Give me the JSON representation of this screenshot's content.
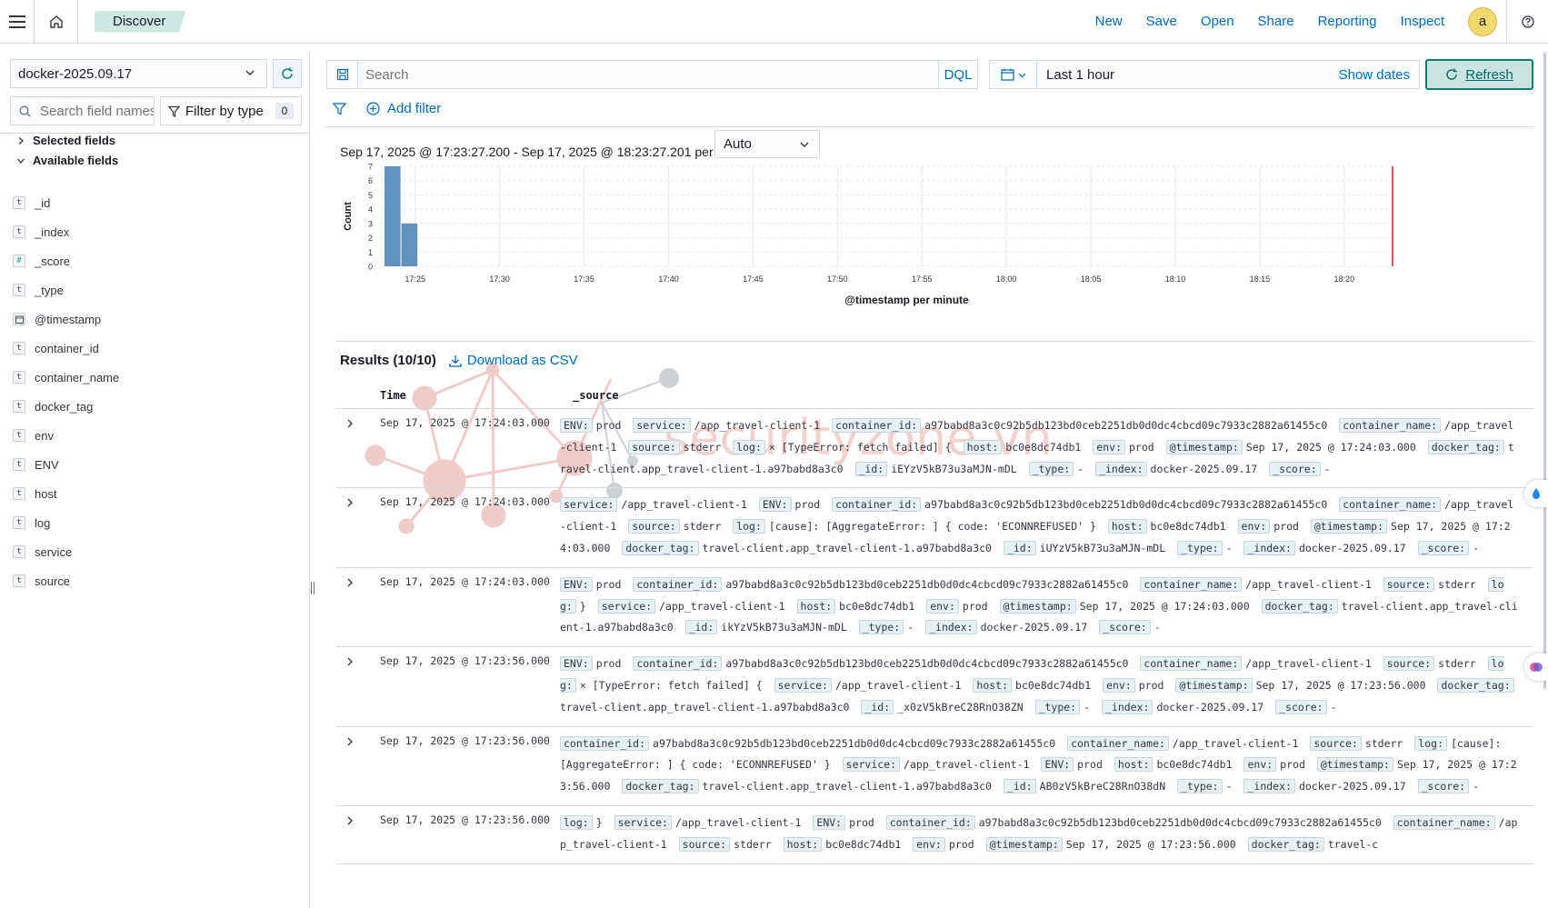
{
  "header": {
    "breadcrumb": "Discover",
    "nav": [
      "New",
      "Save",
      "Open",
      "Share",
      "Reporting",
      "Inspect"
    ],
    "avatar": "a"
  },
  "sidebar": {
    "index_pattern": "docker-2025.09.17",
    "field_search_placeholder": "Search field names",
    "filter_by_type": "Filter by type",
    "filter_count": "0",
    "selected_fields": "Selected fields",
    "available_fields": "Available fields",
    "fields": [
      {
        "type": "t",
        "name": "_id"
      },
      {
        "type": "t",
        "name": "_index"
      },
      {
        "type": "#",
        "name": "_score"
      },
      {
        "type": "t",
        "name": "_type"
      },
      {
        "type": "date",
        "name": "@timestamp"
      },
      {
        "type": "t",
        "name": "container_id"
      },
      {
        "type": "t",
        "name": "container_name"
      },
      {
        "type": "t",
        "name": "docker_tag"
      },
      {
        "type": "t",
        "name": "env"
      },
      {
        "type": "t",
        "name": "ENV"
      },
      {
        "type": "t",
        "name": "host"
      },
      {
        "type": "t",
        "name": "log"
      },
      {
        "type": "t",
        "name": "service"
      },
      {
        "type": "t",
        "name": "source"
      }
    ]
  },
  "query": {
    "placeholder": "Search",
    "language": "DQL",
    "time_range": "Last 1 hour",
    "show_dates": "Show dates",
    "refresh": "Refresh",
    "add_filter": "Add filter"
  },
  "histogram": {
    "interval_text": "Sep 17, 2025 @ 17:23:27.200 - Sep 17, 2025 @ 18:23:27.201 per",
    "interval": "Auto"
  },
  "chart_data": {
    "type": "bar",
    "xlabel": "@timestamp per minute",
    "ylabel": "Count",
    "ylim": [
      0,
      7
    ],
    "yticks": [
      "0",
      "1",
      "2",
      "3",
      "4",
      "5",
      "6",
      "7"
    ],
    "xticks": [
      "17:25",
      "17:30",
      "17:35",
      "17:40",
      "17:45",
      "17:50",
      "17:55",
      "18:00",
      "18:05",
      "18:10",
      "18:15",
      "18:20"
    ],
    "categories": [
      "17:24",
      "17:25"
    ],
    "values": [
      7,
      3
    ],
    "grid": true,
    "color": "#6092c0",
    "now_marker_color": "#bd271e"
  },
  "results": {
    "count_label": "Results (10/10)",
    "download": "Download as CSV",
    "col_time": "Time",
    "col_source": "_source",
    "rows": [
      {
        "time": "Sep 17, 2025 @ 17:24:03.000",
        "fields": [
          [
            "ENV:",
            "prod"
          ],
          [
            "service:",
            "/app_travel-client-1"
          ],
          [
            "container_id:",
            "a97babd8a3c0c92b5db123bd0ceb2251db0d0dc4cbcd09c7933c2882a61455c0"
          ],
          [
            "container_name:",
            "/app_travel-client-1"
          ],
          [
            "source:",
            "stderr"
          ],
          [
            "log:",
            "× [TypeError: fetch failed] {"
          ],
          [
            "host:",
            "bc0e8dc74db1"
          ],
          [
            "env:",
            "prod"
          ],
          [
            "@timestamp:",
            "Sep 17, 2025 @ 17:24:03.000"
          ],
          [
            "docker_tag:",
            "travel-client.app_travel-client-1.a97babd8a3c0"
          ],
          [
            "_id:",
            "iEYzV5kB73u3aMJN-mDL"
          ],
          [
            "_type:",
            "-"
          ],
          [
            "_index:",
            "docker-2025.09.17"
          ],
          [
            "_score:",
            "-"
          ]
        ]
      },
      {
        "time": "Sep 17, 2025 @ 17:24:03.000",
        "fields": [
          [
            "service:",
            "/app_travel-client-1"
          ],
          [
            "ENV:",
            "prod"
          ],
          [
            "container_id:",
            "a97babd8a3c0c92b5db123bd0ceb2251db0d0dc4cbcd09c7933c2882a61455c0"
          ],
          [
            "container_name:",
            "/app_travel-client-1"
          ],
          [
            "source:",
            "stderr"
          ],
          [
            "log:",
            "[cause]: [AggregateError: ] { code: 'ECONNREFUSED' }"
          ],
          [
            "host:",
            "bc0e8dc74db1"
          ],
          [
            "env:",
            "prod"
          ],
          [
            "@timestamp:",
            "Sep 17, 2025 @ 17:24:03.000"
          ],
          [
            "docker_tag:",
            "travel-client.app_travel-client-1.a97babd8a3c0"
          ],
          [
            "_id:",
            "iUYzV5kB73u3aMJN-mDL"
          ],
          [
            "_type:",
            "-"
          ],
          [
            "_index:",
            "docker-2025.09.17"
          ],
          [
            "_score:",
            "-"
          ]
        ]
      },
      {
        "time": "Sep 17, 2025 @ 17:24:03.000",
        "fields": [
          [
            "ENV:",
            "prod"
          ],
          [
            "container_id:",
            "a97babd8a3c0c92b5db123bd0ceb2251db0d0dc4cbcd09c7933c2882a61455c0"
          ],
          [
            "container_name:",
            "/app_travel-client-1"
          ],
          [
            "source:",
            "stderr"
          ],
          [
            "log:",
            "}"
          ],
          [
            "service:",
            "/app_travel-client-1"
          ],
          [
            "host:",
            "bc0e8dc74db1"
          ],
          [
            "env:",
            "prod"
          ],
          [
            "@timestamp:",
            "Sep 17, 2025 @ 17:24:03.000"
          ],
          [
            "docker_tag:",
            "travel-client.app_travel-client-1.a97babd8a3c0"
          ],
          [
            "_id:",
            "ikYzV5kB73u3aMJN-mDL"
          ],
          [
            "_type:",
            "-"
          ],
          [
            "_index:",
            "docker-2025.09.17"
          ],
          [
            "_score:",
            "-"
          ]
        ]
      },
      {
        "time": "Sep 17, 2025 @ 17:23:56.000",
        "fields": [
          [
            "ENV:",
            "prod"
          ],
          [
            "container_id:",
            "a97babd8a3c0c92b5db123bd0ceb2251db0d0dc4cbcd09c7933c2882a61455c0"
          ],
          [
            "container_name:",
            "/app_travel-client-1"
          ],
          [
            "source:",
            "stderr"
          ],
          [
            "log:",
            "× [TypeError: fetch failed] {"
          ],
          [
            "service:",
            "/app_travel-client-1"
          ],
          [
            "host:",
            "bc0e8dc74db1"
          ],
          [
            "env:",
            "prod"
          ],
          [
            "@timestamp:",
            "Sep 17, 2025 @ 17:23:56.000"
          ],
          [
            "docker_tag:",
            "travel-client.app_travel-client-1.a97babd8a3c0"
          ],
          [
            "_id:",
            "_x0zV5kBreC28RnO38ZN"
          ],
          [
            "_type:",
            "-"
          ],
          [
            "_index:",
            "docker-2025.09.17"
          ],
          [
            "_score:",
            "-"
          ]
        ]
      },
      {
        "time": "Sep 17, 2025 @ 17:23:56.000",
        "fields": [
          [
            "container_id:",
            "a97babd8a3c0c92b5db123bd0ceb2251db0d0dc4cbcd09c7933c2882a61455c0"
          ],
          [
            "container_name:",
            "/app_travel-client-1"
          ],
          [
            "source:",
            "stderr"
          ],
          [
            "log:",
            "[cause]: [AggregateError: ] { code: 'ECONNREFUSED' }"
          ],
          [
            "service:",
            "/app_travel-client-1"
          ],
          [
            "ENV:",
            "prod"
          ],
          [
            "host:",
            "bc0e8dc74db1"
          ],
          [
            "env:",
            "prod"
          ],
          [
            "@timestamp:",
            "Sep 17, 2025 @ 17:23:56.000"
          ],
          [
            "docker_tag:",
            "travel-client.app_travel-client-1.a97babd8a3c0"
          ],
          [
            "_id:",
            "AB0zV5kBreC28RnO38dN"
          ],
          [
            "_type:",
            "-"
          ],
          [
            "_index:",
            "docker-2025.09.17"
          ],
          [
            "_score:",
            "-"
          ]
        ]
      },
      {
        "time": "Sep 17, 2025 @ 17:23:56.000",
        "fields": [
          [
            "log:",
            "}"
          ],
          [
            "service:",
            "/app_travel-client-1"
          ],
          [
            "ENV:",
            "prod"
          ],
          [
            "container_id:",
            "a97babd8a3c0c92b5db123bd0ceb2251db0d0dc4cbcd09c7933c2882a61455c0"
          ],
          [
            "container_name:",
            "/app_travel-client-1"
          ],
          [
            "source:",
            "stderr"
          ],
          [
            "host:",
            "bc0e8dc74db1"
          ],
          [
            "env:",
            "prod"
          ],
          [
            "@timestamp:",
            "Sep 17, 2025 @ 17:23:56.000"
          ],
          [
            "docker_tag:",
            "travel-c"
          ]
        ]
      }
    ]
  },
  "watermark": "securityzone.vn"
}
